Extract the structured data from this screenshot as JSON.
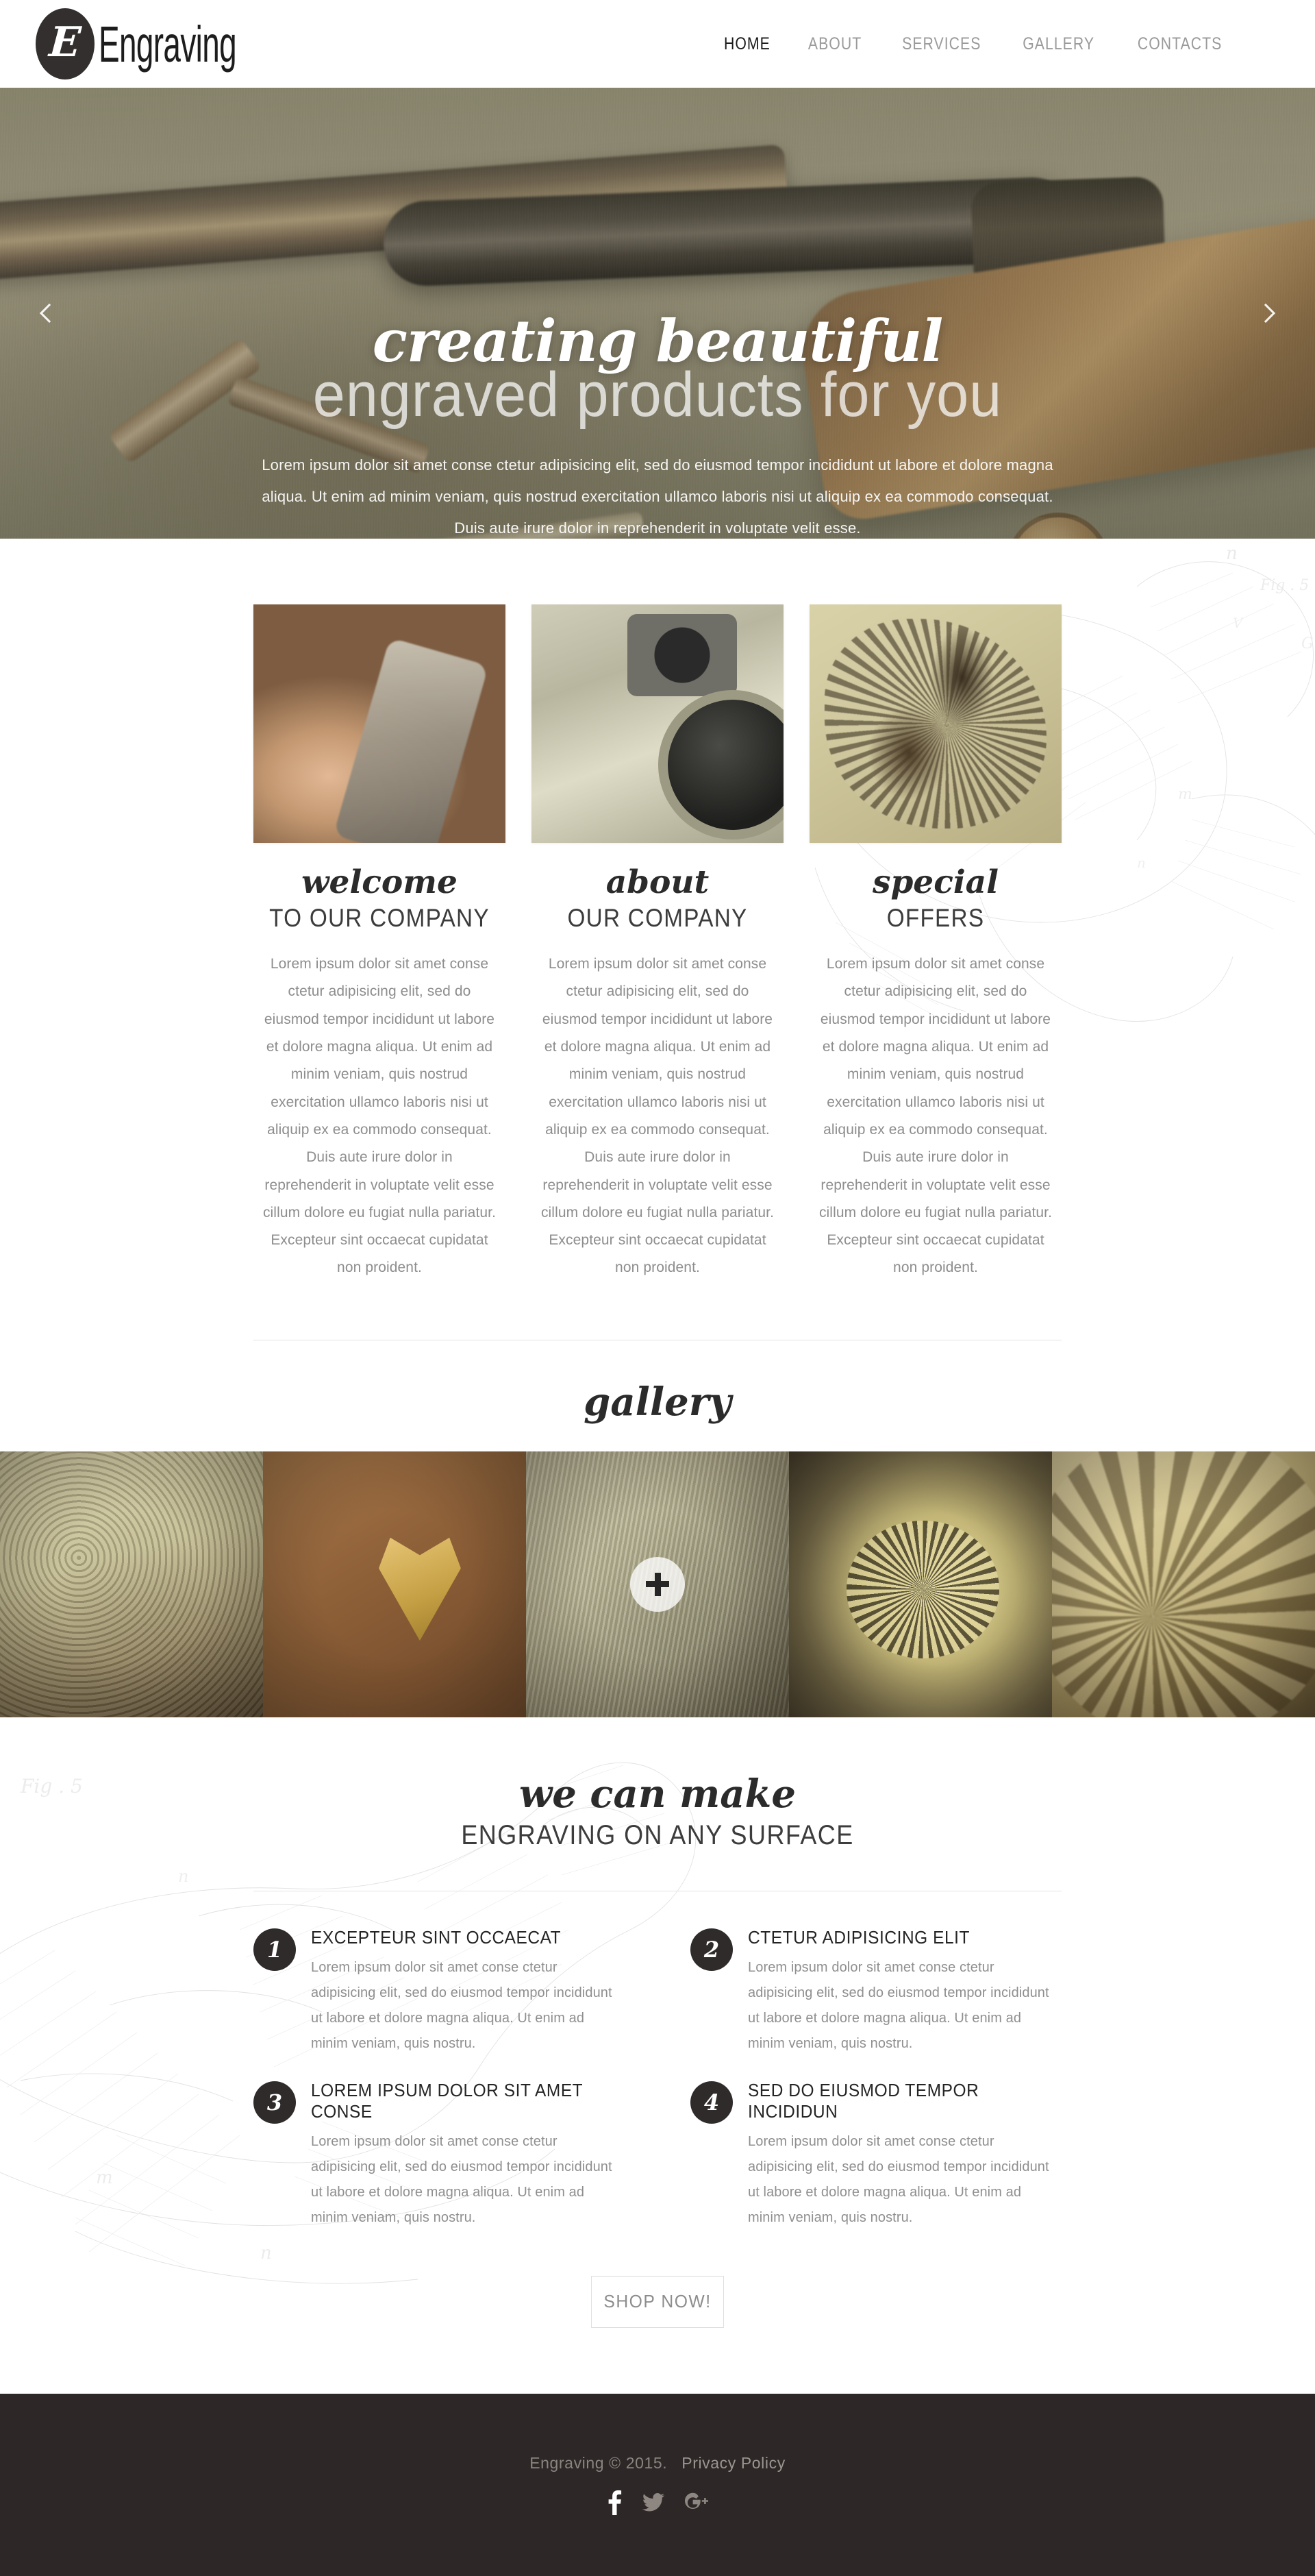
{
  "header": {
    "logo_mark": "E",
    "logo_text": "Engraving",
    "nav": [
      {
        "label": "HOME",
        "active": true
      },
      {
        "label": "ABOUT",
        "active": false
      },
      {
        "label": "SERVICES",
        "active": false
      },
      {
        "label": "GALLERY",
        "active": false
      },
      {
        "label": "CONTACTS",
        "active": false
      }
    ]
  },
  "hero": {
    "title": "creating beautiful",
    "subtitle": "engraved products for you",
    "text": "Lorem ipsum dolor sit amet conse ctetur adipisicing elit, sed do eiusmod tempor incididunt ut labore et dolore magna aliqua. Ut enim ad minim veniam, quis nostrud exercitation ullamco laboris nisi ut aliquip ex ea commodo consequat. Duis aute irure dolor in reprehenderit in voluptate velit esse.",
    "prev_icon": "chevron-left-icon",
    "next_icon": "chevron-right-icon"
  },
  "features": {
    "columns": [
      {
        "title": "welcome",
        "subtitle": "TO OUR COMPANY",
        "body": "Lorem ipsum dolor sit amet conse ctetur adipisicing elit, sed do eiusmod tempor incididunt ut labore et dolore magna aliqua. Ut enim ad minim veniam, quis nostrud exercitation ullamco laboris nisi ut aliquip ex ea commodo consequat. Duis aute irure dolor in reprehenderit in voluptate velit esse cillum dolore eu fugiat nulla pariatur. Excepteur sint occaecat cupidatat non proident.",
        "image_alt": "hand-engraving-photo"
      },
      {
        "title": "about",
        "subtitle": "OUR COMPANY",
        "body": "Lorem ipsum dolor sit amet conse ctetur adipisicing elit, sed do eiusmod tempor incididunt ut labore et dolore magna aliqua. Ut enim ad minim veniam, quis nostrud exercitation ullamco laboris nisi ut aliquip ex ea commodo consequat. Duis aute irure dolor in reprehenderit in voluptate velit esse cillum dolore eu fugiat nulla pariatur. Excepteur sint occaecat cupidatat non proident.",
        "image_alt": "engraving-machine-photo"
      },
      {
        "title": "special",
        "subtitle": "OFFERS",
        "body": "Lorem ipsum dolor sit amet conse ctetur adipisicing elit, sed do eiusmod tempor incididunt ut labore et dolore magna aliqua. Ut enim ad minim veniam, quis nostrud exercitation ullamco laboris nisi ut aliquip ex ea commodo consequat. Duis aute irure dolor in reprehenderit in voluptate velit esse cillum dolore eu fugiat nulla pariatur. Excepteur sint occaecat cupidatat non proident.",
        "image_alt": "scroll-ornament-photo"
      }
    ]
  },
  "gallery": {
    "title": "gallery",
    "plus_icon": "plus-icon",
    "items": [
      {
        "alt": "engraved-rings-tray"
      },
      {
        "alt": "gold-heart-pendant"
      },
      {
        "alt": "engraved-pistol"
      },
      {
        "alt": "engraved-pocket-watch"
      },
      {
        "alt": "filigree-ornaments"
      }
    ]
  },
  "make": {
    "title": "we can make",
    "subtitle": "ENGRAVING ON ANY SURFACE",
    "items": [
      {
        "number": "1",
        "title": "EXCEPTEUR SINT OCCAECAT",
        "body": "Lorem ipsum dolor sit amet conse ctetur adipisicing elit, sed do eiusmod tempor incididunt ut labore et dolore magna aliqua. Ut enim ad minim veniam, quis nostru."
      },
      {
        "number": "2",
        "title": "CTETUR ADIPISICING ELIT",
        "body": "Lorem ipsum dolor sit amet conse ctetur adipisicing elit, sed do eiusmod tempor incididunt ut labore et dolore magna aliqua. Ut enim ad minim veniam, quis nostru."
      },
      {
        "number": "3",
        "title": "LOREM IPSUM DOLOR SIT AMET CONSE",
        "body": "Lorem ipsum dolor sit amet conse ctetur adipisicing elit, sed do eiusmod tempor incididunt ut labore et dolore magna aliqua. Ut enim ad minim veniam, quis nostru."
      },
      {
        "number": "4",
        "title": "SED DO EIUSMOD TEMPOR INCIDIDUN",
        "body": "Lorem ipsum dolor sit amet conse ctetur adipisicing elit, sed do eiusmod tempor incididunt ut labore et dolore magna aliqua. Ut enim ad minim veniam, quis nostru."
      }
    ],
    "shop_button": "SHOP NOW!"
  },
  "footer": {
    "copyright": "Engraving © 2015.",
    "privacy": "Privacy Policy",
    "socials": [
      {
        "name": "facebook-icon"
      },
      {
        "name": "twitter-icon"
      },
      {
        "name": "google-plus-icon"
      }
    ]
  },
  "colors": {
    "dark": "#2d2827",
    "accent_text": "#2b2b2b",
    "muted_text": "#8d8d8d",
    "nav_inactive": "#9a9a9a"
  }
}
